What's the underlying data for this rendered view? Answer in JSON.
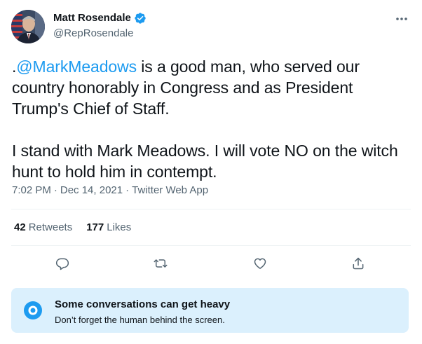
{
  "author": {
    "name": "Matt Rosendale",
    "handle": "@RepRosendale",
    "verified": true
  },
  "tweet": {
    "prefix": ".",
    "mention": "@MarkMeadows",
    "paragraph1_rest": " is a good man, who served our country honorably in Congress and as President Trump's Chief of Staff.",
    "paragraph2": "I stand with Mark Meadows. I will vote NO on the witch hunt to hold him in contempt."
  },
  "meta": {
    "time": "7:02 PM",
    "separator1": "·",
    "date": "Dec 14, 2021",
    "separator2": "·",
    "source": "Twitter Web App"
  },
  "stats": {
    "retweets_count": "42",
    "retweets_label": "Retweets",
    "likes_count": "177",
    "likes_label": "Likes"
  },
  "actions": [
    "reply-icon",
    "retweet-icon",
    "like-icon",
    "share-icon"
  ],
  "notice": {
    "title": "Some conversations can get heavy",
    "subtitle": "Don’t forget the human behind the screen."
  },
  "colors": {
    "accent": "#1d9bf0",
    "text": "#0f1419",
    "secondary": "#536471",
    "notice_bg": "#dbf0fd"
  }
}
